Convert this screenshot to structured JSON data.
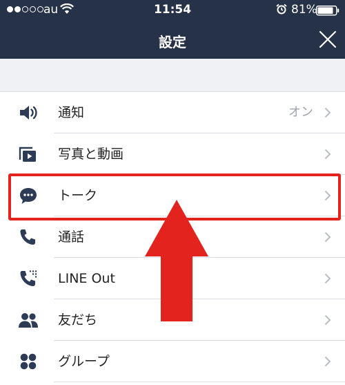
{
  "status_bar": {
    "carrier": "au",
    "time": "11:54",
    "battery": "81%"
  },
  "header": {
    "title": "設定"
  },
  "settings": {
    "items": [
      {
        "label": "通知",
        "value": "オン",
        "icon": "speaker-icon"
      },
      {
        "label": "写真と動画",
        "icon": "photo-video-icon"
      },
      {
        "label": "トーク",
        "icon": "chat-bubble-icon"
      },
      {
        "label": "通話",
        "icon": "phone-icon"
      },
      {
        "label": "LINE Out",
        "icon": "line-out-phone-icon"
      },
      {
        "label": "友だち",
        "icon": "friends-icon"
      },
      {
        "label": "グループ",
        "icon": "group-icon"
      }
    ]
  },
  "annotation": {
    "highlight_color": "#e2231e",
    "highlighted_item": "トーク"
  },
  "colors": {
    "header_bg": "#263248",
    "icon": "#2d3b55",
    "divider": "#dadde2",
    "section_bg": "#eff1f5"
  }
}
